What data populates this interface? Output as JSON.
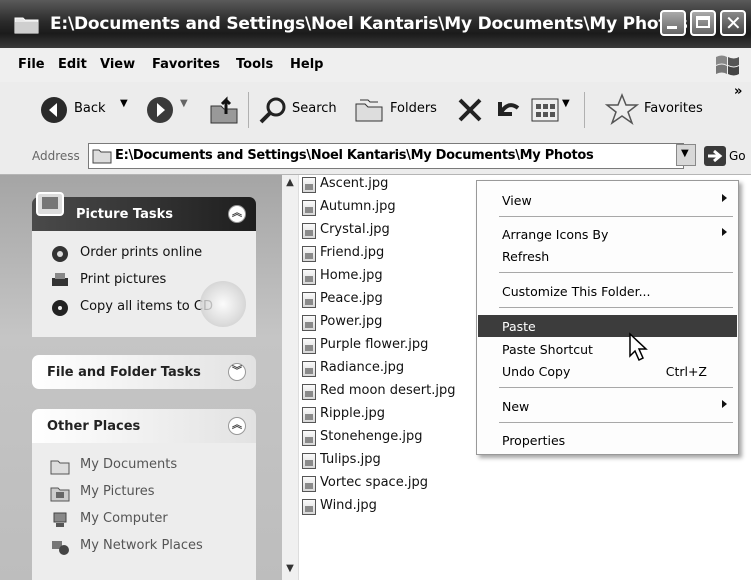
{
  "window": {
    "title": "E:\\Documents and Settings\\Noel Kantaris\\My Documents\\My Photos"
  },
  "menubar": {
    "items": [
      "File",
      "Edit",
      "View",
      "Favorites",
      "Tools",
      "Help"
    ]
  },
  "toolbar": {
    "back_label": "Back",
    "search_label": "Search",
    "folders_label": "Folders",
    "favorites_label": "Favorites",
    "overflow": "»"
  },
  "address": {
    "label": "Address",
    "value": "E:\\Documents and Settings\\Noel Kantaris\\My Documents\\My Photos",
    "go_label": "Go"
  },
  "sidebar": {
    "picture_tasks": {
      "title": "Picture Tasks",
      "links": [
        "Order prints online",
        "Print pictures",
        "Copy all items to CD"
      ]
    },
    "file_folder_tasks": {
      "title": "File and Folder Tasks"
    },
    "other_places": {
      "title": "Other Places",
      "links": [
        "My Documents",
        "My Pictures",
        "My Computer",
        "My Network Places"
      ]
    }
  },
  "files": [
    "Ascent.jpg",
    "Autumn.jpg",
    "Crystal.jpg",
    "Friend.jpg",
    "Home.jpg",
    "Peace.jpg",
    "Power.jpg",
    "Purple flower.jpg",
    "Radiance.jpg",
    "Red moon desert.jpg",
    "Ripple.jpg",
    "Stonehenge.jpg",
    "Tulips.jpg",
    "Vortec space.jpg",
    "Wind.jpg"
  ],
  "context_menu": {
    "view": "View",
    "arrange": "Arrange Icons By",
    "refresh": "Refresh",
    "customize": "Customize This Folder...",
    "paste": "Paste",
    "paste_shortcut": "Paste Shortcut",
    "undo_copy": "Undo Copy",
    "undo_shortcut": "Ctrl+Z",
    "new": "New",
    "properties": "Properties",
    "highlighted": "Paste"
  }
}
